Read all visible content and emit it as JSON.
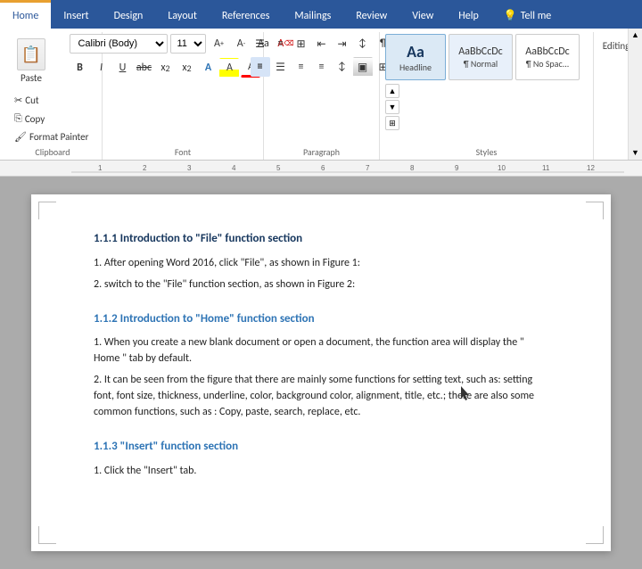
{
  "ribbon": {
    "tabs": [
      {
        "label": "Home",
        "active": true
      },
      {
        "label": "Insert",
        "active": false
      },
      {
        "label": "Design",
        "active": false
      },
      {
        "label": "Layout",
        "active": false
      },
      {
        "label": "References",
        "active": false
      },
      {
        "label": "Mailings",
        "active": false
      },
      {
        "label": "Review",
        "active": false
      },
      {
        "label": "View",
        "active": false
      },
      {
        "label": "Help",
        "active": false
      },
      {
        "label": "✦ Tell me",
        "active": false
      }
    ],
    "groups": {
      "clipboard": {
        "label": "Clipboard",
        "paste_label": "Paste",
        "cut_label": "Cut",
        "copy_label": "Copy",
        "format_painter_label": "Format Painter"
      },
      "font": {
        "label": "Font",
        "font_name": "Calibri (Body)",
        "font_size": "11",
        "bold": "B",
        "italic": "I",
        "underline": "U",
        "strikethrough": "abc",
        "subscript": "x₂",
        "superscript": "x²",
        "case_btn": "Aa",
        "highlight_label": "A",
        "font_color_label": "A"
      },
      "paragraph": {
        "label": "Paragraph"
      },
      "styles": {
        "label": "Styles",
        "items": [
          {
            "label": "Aa",
            "sublabel": "Headline",
            "type": "headline"
          },
          {
            "label": "¶ Normal",
            "sublabel": "",
            "type": "normal"
          },
          {
            "label": "¶ No Spac...",
            "sublabel": "",
            "type": "nospace"
          }
        ]
      },
      "editing": {
        "label": "Editing"
      }
    }
  },
  "document": {
    "sections": [
      {
        "heading": "1.1.1 Introduction to \"File\" function section",
        "paragraphs": [
          "1. After opening Word 2016, click \"File\", as shown in Figure 1:",
          "2. switch to the \"File\" function section, as shown in Figure 2:"
        ]
      },
      {
        "heading": "1.1.2 Introduction to “Home” function section",
        "paragraphs": [
          "1. When you create a new blank document or open a document, the function area will display the \" Home \" tab by default.",
          "2. It can be seen from the figure that there are mainly some functions for setting text, such as: setting font, font size, thickness, underline, color, background color, alignment, title, etc.; there are also some common functions, such as : Copy, paste, search, replace, etc."
        ]
      },
      {
        "heading": "1.1.3 \"Insert\" function section",
        "paragraphs": [
          "1. Click the \"Insert\" tab."
        ]
      }
    ]
  },
  "styles_panel": {
    "title": "Editing"
  }
}
